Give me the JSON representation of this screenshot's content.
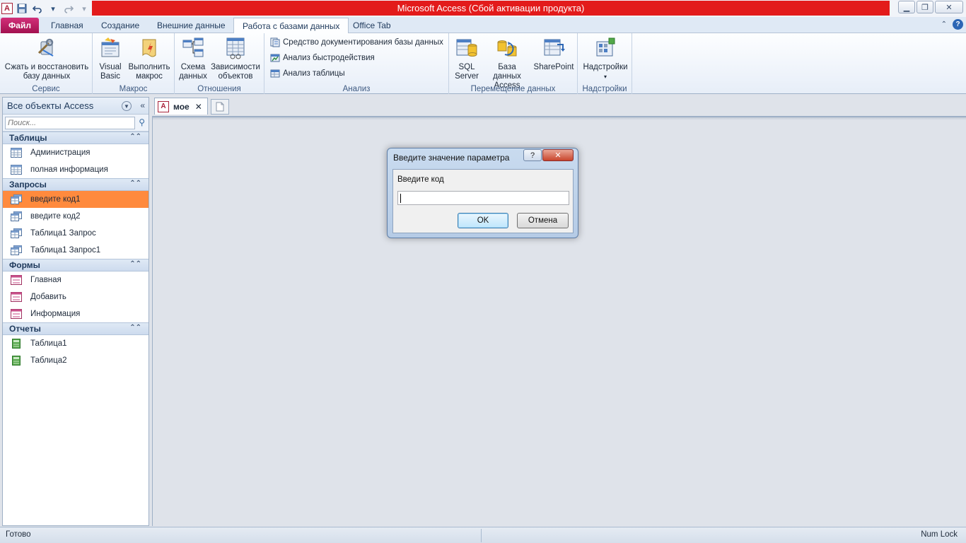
{
  "window": {
    "title": "Microsoft Access (Сбой активации продукта)",
    "app_icon": "A"
  },
  "qat": {
    "icons": [
      "save-icon",
      "undo-icon",
      "redo-icon",
      "customize-icon"
    ]
  },
  "tabs": [
    {
      "label": "Файл"
    },
    {
      "label": "Главная"
    },
    {
      "label": "Создание"
    },
    {
      "label": "Внешние данные"
    },
    {
      "label": "Работа с базами данных"
    },
    {
      "label": "Office Tab"
    }
  ],
  "ribbon": {
    "groups": {
      "service": {
        "label": "Сервис",
        "compact_line1": "Сжать и восстановить",
        "compact_line2": "базу данных"
      },
      "macro": {
        "label": "Макрос",
        "vb_line1": "Visual",
        "vb_line2": "Basic",
        "run_line1": "Выполнить",
        "run_line2": "макрос"
      },
      "relations": {
        "label": "Отношения",
        "schema_line1": "Схема",
        "schema_line2": "данных",
        "deps_line1": "Зависимости",
        "deps_line2": "объектов"
      },
      "analysis": {
        "label": "Анализ",
        "doc": "Средство документирования базы данных",
        "perf": "Анализ быстродействия",
        "table": "Анализ таблицы"
      },
      "move": {
        "label": "Перемещение данных",
        "sql_line1": "SQL",
        "sql_line2": "Server",
        "access_line1": "База данных",
        "access_line2": "Access",
        "sharepoint": "SharePoint"
      },
      "addins": {
        "label": "Надстройки",
        "btn": "Надстройки"
      }
    }
  },
  "nav": {
    "title": "Все объекты Access",
    "search_placeholder": "Поиск...",
    "sections": [
      {
        "title": "Таблицы",
        "items": [
          "Администрация",
          "полная информация"
        ]
      },
      {
        "title": "Запросы",
        "items": [
          "введите код1",
          "введите код2",
          "Таблица1 Запрос",
          "Таблица1 Запрос1"
        ]
      },
      {
        "title": "Формы",
        "items": [
          "Главная",
          "Добавить",
          "Информация"
        ]
      },
      {
        "title": "Отчеты",
        "items": [
          "Таблица1",
          "Таблица2"
        ]
      }
    ]
  },
  "doc": {
    "tab_label": "мое",
    "tab_icon": "A"
  },
  "dialog": {
    "title": "Введите значение параметра",
    "help": "?",
    "prompt": "Введите код",
    "value": "",
    "ok": "OK",
    "cancel": "Отмена"
  },
  "status": {
    "left": "Готово",
    "right": "Num Lock"
  }
}
